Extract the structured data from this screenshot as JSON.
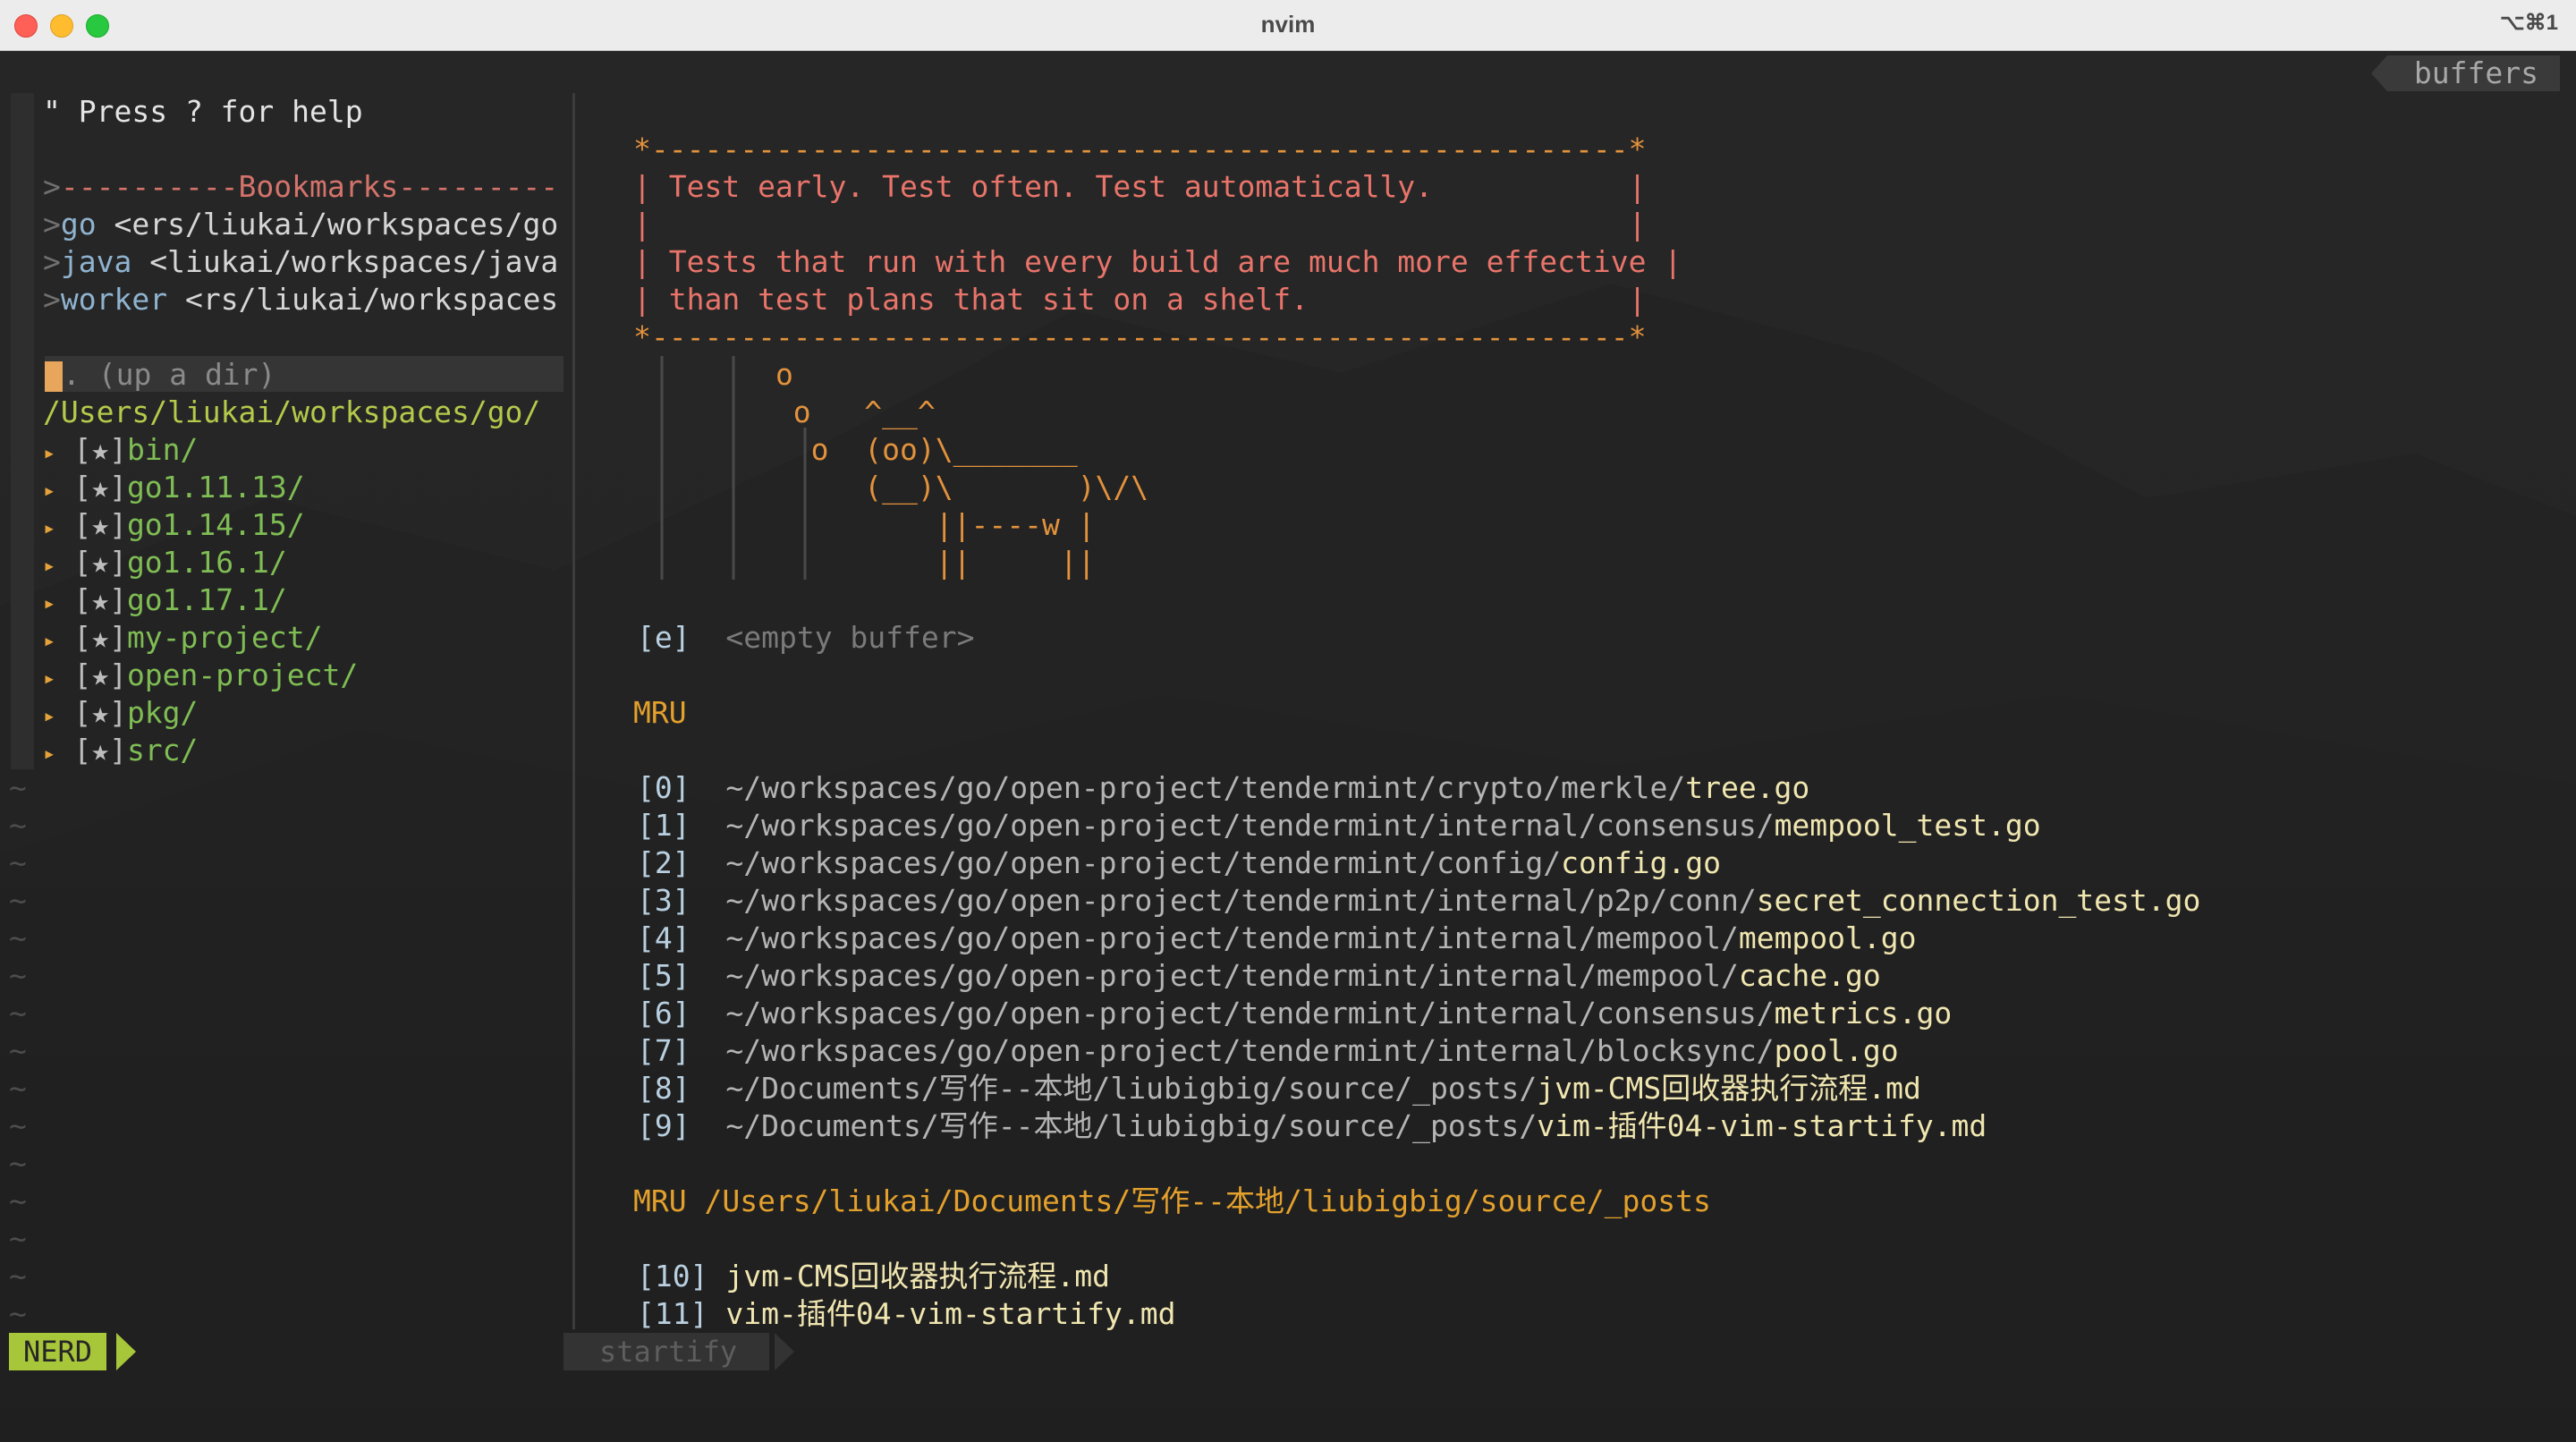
{
  "window": {
    "title": "nvim",
    "shortcut": "⌥⌘1"
  },
  "buffers_tab": "buffers",
  "nerdtree": {
    "help": "\" Press ? for help",
    "bookmarks_header": "----------Bookmarks---------",
    "bookmarks": [
      {
        "name": "go",
        "path": " <ers/liukai/workspaces/go"
      },
      {
        "name": "java",
        "path": " <liukai/workspaces/java"
      },
      {
        "name": "worker",
        "path": " <rs/liukai/workspaces"
      }
    ],
    "updir": ". (up a dir)",
    "root": "/Users/liukai/workspaces/go/",
    "dirs": [
      "bin/",
      "go1.11.13/",
      "go1.14.15/",
      "go1.16.1/",
      "go1.17.1/",
      "my-project/",
      "open-project/",
      "pkg/",
      "src/"
    ],
    "tree_arrow": "▸",
    "star": "[★]",
    "tilde": "~",
    "status": "NERD"
  },
  "startify": {
    "box_top": "*-------------------------------------------------------*",
    "box_bottom": "*-------------------------------------------------------*",
    "box_lines": [
      "| Test early. Test often. Test automatically.           |",
      "|                                                       |",
      "| Tests that run with every build are much more effective |",
      "| than test plans that sit on a shelf.                  |"
    ],
    "cow": [
      "        o",
      "         o   ^__^",
      "          o  (oo)\\_______",
      "             (__)\\       )\\/\\",
      "                 ||----w |",
      "                 ||     ||"
    ],
    "empty_index": "[e]",
    "empty_label": "<empty buffer>",
    "mru_header": "MRU",
    "mru": [
      {
        "idx": "[0]",
        "dir": "~/workspaces/go/open-project/tendermint/crypto/merkle/",
        "file": "tree.go"
      },
      {
        "idx": "[1]",
        "dir": "~/workspaces/go/open-project/tendermint/internal/consensus/",
        "file": "mempool_test.go"
      },
      {
        "idx": "[2]",
        "dir": "~/workspaces/go/open-project/tendermint/config/",
        "file": "config.go"
      },
      {
        "idx": "[3]",
        "dir": "~/workspaces/go/open-project/tendermint/internal/p2p/conn/",
        "file": "secret_connection_test.go"
      },
      {
        "idx": "[4]",
        "dir": "~/workspaces/go/open-project/tendermint/internal/mempool/",
        "file": "mempool.go"
      },
      {
        "idx": "[5]",
        "dir": "~/workspaces/go/open-project/tendermint/internal/mempool/",
        "file": "cache.go"
      },
      {
        "idx": "[6]",
        "dir": "~/workspaces/go/open-project/tendermint/internal/consensus/",
        "file": "metrics.go"
      },
      {
        "idx": "[7]",
        "dir": "~/workspaces/go/open-project/tendermint/internal/blocksync/",
        "file": "pool.go"
      },
      {
        "idx": "[8]",
        "dir": "~/Documents/写作--本地/liubigbig/source/_posts/",
        "file": "jvm-CMS回收器执行流程.md"
      },
      {
        "idx": "[9]",
        "dir": "~/Documents/写作--本地/liubigbig/source/_posts/",
        "file": "vim-插件04-vim-startify.md"
      }
    ],
    "mru_dir_header": "MRU /Users/liukai/Documents/写作--本地/liubigbig/source/_posts",
    "mru_dir": [
      {
        "idx": "[10]",
        "file": "jvm-CMS回收器执行流程.md"
      },
      {
        "idx": "[11]",
        "file": "vim-插件04-vim-startify.md"
      }
    ],
    "status": "startify"
  }
}
